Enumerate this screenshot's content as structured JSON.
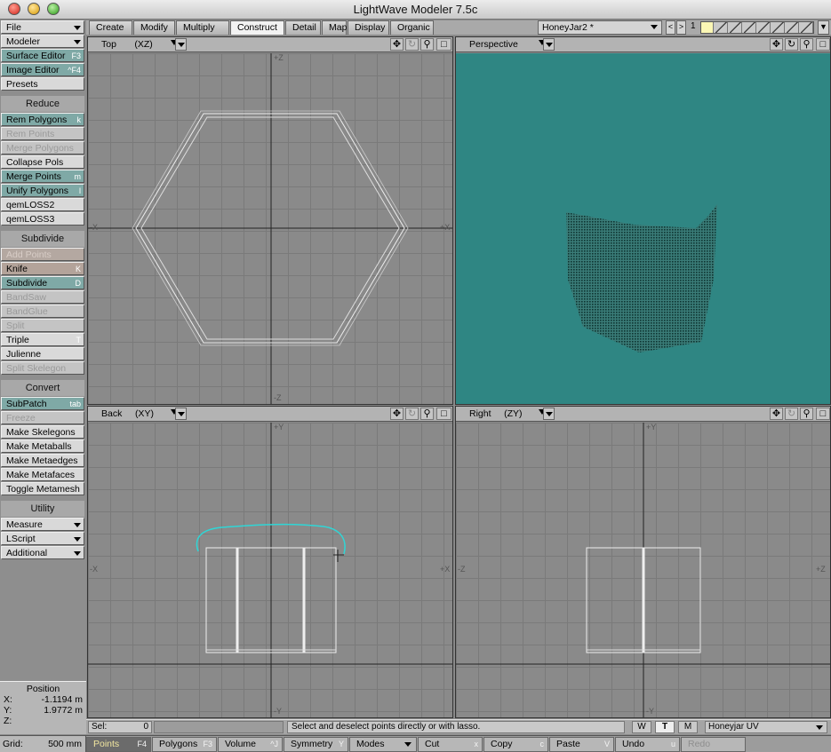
{
  "window": {
    "title": "LightWave Modeler 7.5c"
  },
  "toolbar": {
    "top": [
      {
        "label": "File",
        "dropdown": true,
        "style": "light"
      },
      {
        "label": "Modeler",
        "dropdown": true,
        "style": "light"
      },
      {
        "label": "Surface Editor",
        "key": "F3",
        "style": "teal"
      },
      {
        "label": "Image Editor",
        "key": "^F4",
        "style": "teal"
      },
      {
        "label": "Presets",
        "key": "",
        "style": "light"
      }
    ],
    "reduce_header": "Reduce",
    "reduce": [
      {
        "label": "Rem Polygons",
        "key": "k",
        "style": "teal"
      },
      {
        "label": "Rem Points",
        "key": "",
        "style": "disabled"
      },
      {
        "label": "Merge Polygons",
        "key": "",
        "style": "disabled"
      },
      {
        "label": "Collapse Pols",
        "key": "",
        "style": "light"
      },
      {
        "label": "Merge Points",
        "key": "m",
        "style": "teal"
      },
      {
        "label": "Unify Polygons",
        "key": "l",
        "style": "teal"
      },
      {
        "label": "qemLOSS2",
        "key": "",
        "style": "light"
      },
      {
        "label": "qemLOSS3",
        "key": "",
        "style": "light"
      }
    ],
    "subdivide_header": "Subdivide",
    "subdivide": [
      {
        "label": "Add Points",
        "key": "",
        "style": "tan disabled"
      },
      {
        "label": "Knife",
        "key": "K",
        "style": "tan"
      },
      {
        "label": "Subdivide",
        "key": "D",
        "style": "teal"
      },
      {
        "label": "BandSaw",
        "key": "",
        "style": "disabled"
      },
      {
        "label": "BandGlue",
        "key": "",
        "style": "disabled"
      },
      {
        "label": "Split",
        "key": "",
        "style": "disabled"
      },
      {
        "label": "Triple",
        "key": "T",
        "style": "light"
      },
      {
        "label": "Julienne",
        "key": "",
        "style": "light"
      },
      {
        "label": "Split Skelegon",
        "key": "",
        "style": "disabled"
      }
    ],
    "convert_header": "Convert",
    "convert": [
      {
        "label": "SubPatch",
        "key": "tab",
        "style": "teal"
      },
      {
        "label": "Freeze",
        "key": "",
        "style": "disabled"
      },
      {
        "label": "Make Skelegons",
        "key": "",
        "style": "light"
      },
      {
        "label": "Make Metaballs",
        "key": "",
        "style": "light"
      },
      {
        "label": "Make Metaedges",
        "key": "",
        "style": "light"
      },
      {
        "label": "Make Metafaces",
        "key": "",
        "style": "light"
      },
      {
        "label": "Toggle Metamesh",
        "key": "",
        "style": "light"
      }
    ],
    "utility_header": "Utility",
    "utility": [
      {
        "label": "Measure",
        "dropdown": true,
        "style": "light"
      },
      {
        "label": "LScript",
        "dropdown": true,
        "style": "light"
      },
      {
        "label": "Additional",
        "dropdown": true,
        "style": "light"
      }
    ]
  },
  "position": {
    "title": "Position",
    "x_label": "X:",
    "x_value": "-1.1194 m",
    "y_label": "Y:",
    "y_value": "1.9772 m",
    "z_label": "Z:",
    "z_value": ""
  },
  "tabs": [
    "Create",
    "Modify",
    "Multiply",
    "Construct",
    "Detail",
    "Map",
    "Display",
    "Organic"
  ],
  "active_tab": "Construct",
  "object": {
    "name": "HoneyJar2 *",
    "layer_number": "1"
  },
  "viewports": {
    "top": {
      "label": "Top",
      "axes": "(XZ)"
    },
    "perspective": {
      "label": "Perspective"
    },
    "back": {
      "label": "Back",
      "axes": "(XY)"
    },
    "right": {
      "label": "Right",
      "axes": "(ZY)"
    }
  },
  "axis_labels": {
    "plus_z": "+Z",
    "minus_z": "-Z",
    "minus_x": "-X",
    "plus_x": "+X",
    "plus_y": "+Y",
    "minus_y": "-Y"
  },
  "status": {
    "sel_label": "Sel:",
    "sel_value": "0",
    "message": "Select and deselect points directly or with lasso.",
    "w": "W",
    "t": "T",
    "m": "M",
    "uv_map": "Honeyjar UV"
  },
  "bottom": {
    "grid_label": "Grid:",
    "grid_value": "500 mm",
    "buttons": [
      {
        "label": "Points",
        "key": "F4",
        "active": true
      },
      {
        "label": "Polygons",
        "key": "F3"
      },
      {
        "label": "Volume",
        "key": "^J"
      },
      {
        "label": "Symmetry",
        "key": "Y"
      },
      {
        "label": "Modes",
        "dropdown": true
      },
      {
        "label": "Cut",
        "key": "x"
      },
      {
        "label": "Copy",
        "key": "c"
      },
      {
        "label": "Paste",
        "key": "V"
      },
      {
        "label": "Undo",
        "key": "u"
      },
      {
        "label": "Redo",
        "key": "",
        "disabled": true
      }
    ]
  },
  "colors": {
    "perspective_bg": "#2f8683",
    "selection_curve": "#2fd6d6",
    "wireframe": "#e8e8e8"
  }
}
